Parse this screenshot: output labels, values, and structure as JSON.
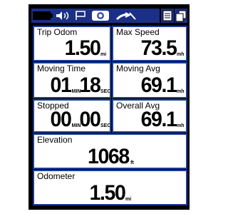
{
  "status_bar": {
    "icons": [
      "battery-icon",
      "sound-icon",
      "flag-icon",
      "satellite-icon",
      "wireless-icon",
      "menu-icon",
      "page-icon"
    ]
  },
  "fields": {
    "trip_odom": {
      "label": "Trip Odom",
      "value": "1.50",
      "unit": "mi"
    },
    "max_speed": {
      "label": "Max Speed",
      "value": "73.5",
      "unit": "mh"
    },
    "moving_time": {
      "label": "Moving Time",
      "hours": "01",
      "hours_unit": "MIN",
      "minutes": "18",
      "minutes_unit": "SEC"
    },
    "moving_avg": {
      "label": "Moving Avg",
      "value": "69.1",
      "unit": "mh"
    },
    "stopped": {
      "label": "Stopped",
      "hours": "00",
      "hours_unit": "MIN",
      "minutes": "00",
      "minutes_unit": "SEC"
    },
    "overall_avg": {
      "label": "Overall Avg",
      "value": "69.1",
      "unit": "mh"
    },
    "elevation": {
      "label": "Elevation",
      "value": "1068",
      "unit": "ft"
    },
    "odometer": {
      "label": "Odometer",
      "value": "1.50",
      "unit": "mi"
    }
  },
  "colors": {
    "frame": "#000000",
    "status_bar": "#1c2f87",
    "cell_border": "#1f3d96",
    "cell_bg": "#ffffff"
  }
}
